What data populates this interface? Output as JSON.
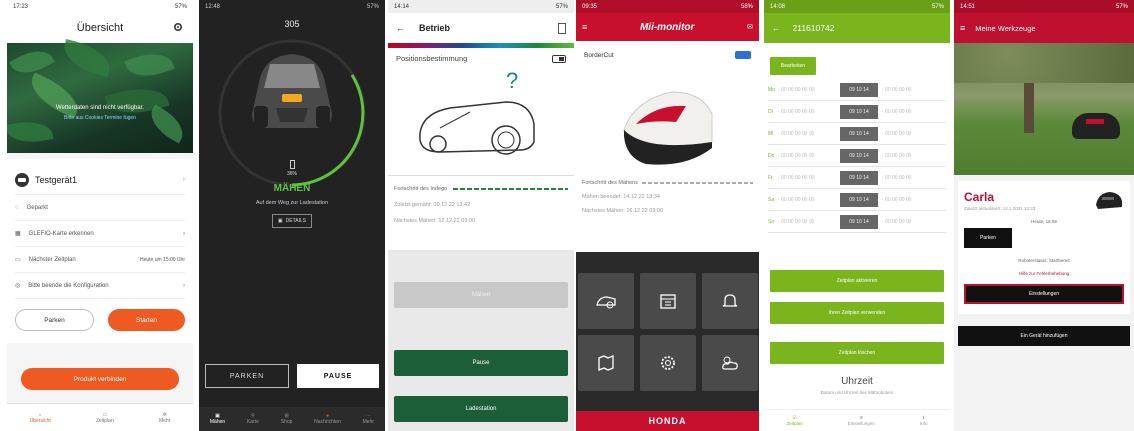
{
  "phone1": {
    "status": {
      "time": "17:23",
      "battery": "57%"
    },
    "title": "Übersicht",
    "weather": {
      "line1": "Wetterdaten sind nicht verfügbar.",
      "line2": "Bitte aus Cookies Termine fügen"
    },
    "device": "Testgerät1",
    "list": [
      "Geparkt",
      "GLEFIO-Karte erkennen",
      "Nächster Zeitplan",
      "Bitte beende die Konfiguration"
    ],
    "next_value": "Heute um 15:00 Uhr",
    "btn_park": "Parken",
    "btn_start": "Starten",
    "btn_connect": "Produkt verbinden",
    "nav": [
      "Übersicht",
      "Zeitplan",
      "Mehr"
    ],
    "accent": "#ef5a23"
  },
  "phone2": {
    "status": {
      "time": "12:48",
      "battery": "57%"
    },
    "number": "305",
    "battery_pct": "36%",
    "state": "MÄHEN",
    "sub": "Auf dem Weg zur Ladestation",
    "info_btn": "DETAILS",
    "btn_park": "PARKEN",
    "btn_pause": "PAUSE",
    "nav": [
      "Mähen",
      "Karte",
      "Shop",
      "Nachrichten",
      "Mehr"
    ],
    "accent": "#5ec33b"
  },
  "phone3": {
    "status": {
      "time": "14:14",
      "battery": "57%"
    },
    "title": "Betrieb",
    "section": "Positionsbestimmung",
    "question": "?",
    "progress": "Fortschritt des Indego",
    "last": "Zuletzt gemäht: 09.12.22 13:42",
    "next": "Nächstes Mähen: 12.12.22 09:00",
    "btn_start": "Mähen",
    "btn_pause": "Pause",
    "btn_dock": "Ladestation",
    "accent": "#1b5e38"
  },
  "phone4": {
    "status": {
      "time": "09:35",
      "battery": "58%"
    },
    "logo": "Mii-monitor",
    "label": "BorderCut",
    "progress": "Fortschritt des Mähens",
    "last": "Mähen beendet: 14.12.22 13:34",
    "next": "Nächstes Mähen: 16.12.22 09:00",
    "brand": "HONDA",
    "tiles": [
      "mower-icon",
      "calendar-icon",
      "bell-icon",
      "map-icon",
      "gear-icon",
      "weather-icon"
    ],
    "accent": "#c8102e"
  },
  "phone5": {
    "status": {
      "time": "14:08",
      "battery": "57%"
    },
    "title": "211610742",
    "tab": "Bearbeiten",
    "days": [
      "Mo",
      "Di",
      "Mi",
      "Do",
      "Fr",
      "Sa",
      "So"
    ],
    "block": "09 10 14",
    "btn1": "Zeitplan aktivieren",
    "btn2": "Ihren Zeitplan verwenden",
    "btn3": "Zeitplan löschen",
    "section": "Uhrzeit",
    "section_sub": "Datum und Uhrzeit des Mähroboters",
    "nav": [
      "Zeitplan",
      "Einstellungen",
      "Info"
    ],
    "accent": "#7ab51d"
  },
  "phone6": {
    "status": {
      "time": "14:51",
      "battery": "57%"
    },
    "title": "Meine Werkzeuge",
    "name": "Carla",
    "subtitle": "Zuletzt aktualisiert: 12.1.2021 12:33",
    "detail": "Heute, 16:59",
    "btn_home": "Parken",
    "status_text": "Roboterstatus: Startbereit",
    "link": "Hilfe zur Fehlerbehebung",
    "btn_settings": "Einstellungen",
    "btn_add": "Ein Gerät hinzufügen",
    "accent": "#c0102f"
  }
}
